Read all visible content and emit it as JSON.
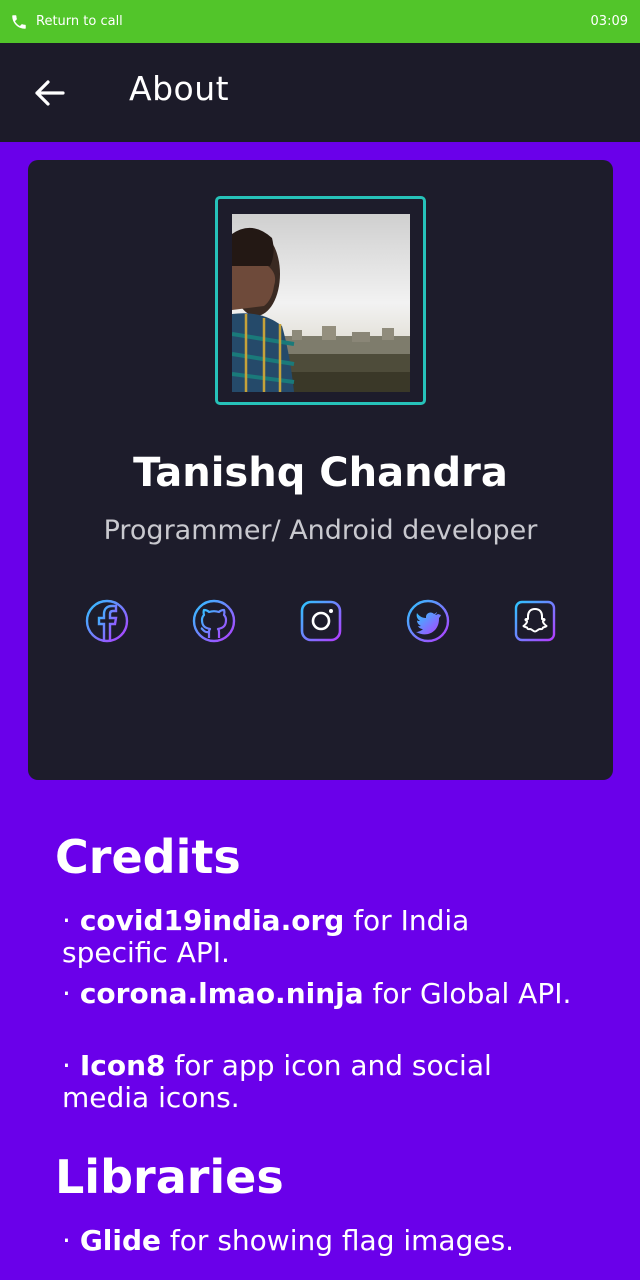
{
  "callbar": {
    "label": "Return to call",
    "time": "03:09",
    "icon": "phone-icon",
    "color": "#52c52a"
  },
  "toolbar": {
    "back_icon": "arrow-left-icon",
    "title": "About",
    "background": "#1c1b29"
  },
  "profile": {
    "name": "Tanishq Chandra",
    "role": "Programmer/ Android developer",
    "frame_color": "#26c2b9",
    "social_links": [
      {
        "icon": "facebook-icon"
      },
      {
        "icon": "github-icon"
      },
      {
        "icon": "instagram-icon"
      },
      {
        "icon": "twitter-icon"
      },
      {
        "icon": "snapchat-icon"
      }
    ]
  },
  "credits": {
    "title": "Credits",
    "items": [
      {
        "bullet": "· ",
        "name": "covid19india.org",
        "text": " for India specific API."
      },
      {
        "bullet": "· ",
        "name": "corona.lmao.ninja",
        "text": " for Global API."
      },
      {
        "bullet": "· ",
        "name": "Icon8",
        "text": " for app icon and social media icons."
      }
    ]
  },
  "libraries": {
    "title": "Libraries",
    "items": [
      {
        "bullet": "· ",
        "name": "Glide",
        "text": " for showing flag images."
      }
    ]
  },
  "colors": {
    "background": "#6a00ea",
    "card": "#1d1c2b",
    "icon_gradient_start": "#2ec5ff",
    "icon_gradient_end": "#b43bff"
  }
}
